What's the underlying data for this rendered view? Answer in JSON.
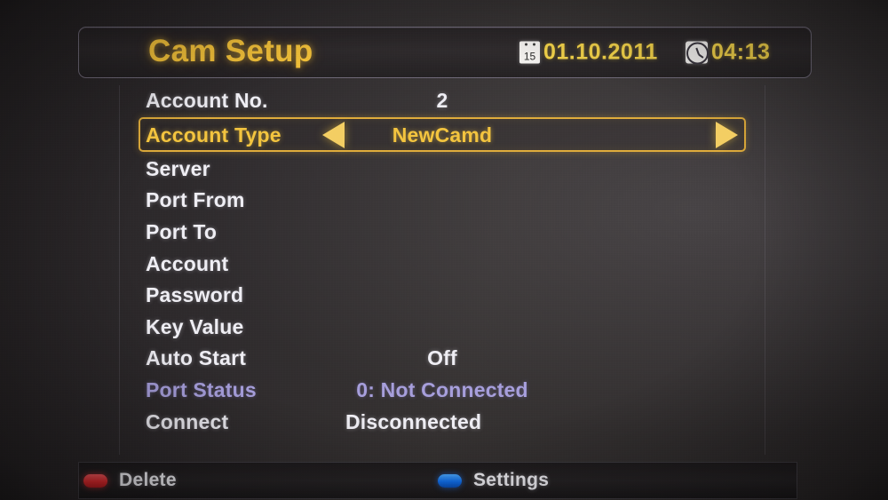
{
  "header": {
    "title": "Cam Setup",
    "date_icon": "calendar-icon",
    "date_icon_day": "15",
    "date": "01.10.2011",
    "time_icon": "clock-icon",
    "time": "04:13"
  },
  "menu": {
    "rows": [
      {
        "label": "Account No.",
        "value": "2",
        "state": "normal",
        "selected": false
      },
      {
        "label": "Account Type",
        "value": "NewCamd",
        "state": "normal",
        "selected": true
      },
      {
        "label": "Server",
        "value": "",
        "state": "normal",
        "selected": false
      },
      {
        "label": "Port From",
        "value": "",
        "state": "normal",
        "selected": false
      },
      {
        "label": "Port To",
        "value": "",
        "state": "normal",
        "selected": false
      },
      {
        "label": "Account",
        "value": "",
        "state": "normal",
        "selected": false
      },
      {
        "label": "Password",
        "value": "",
        "state": "normal",
        "selected": false
      },
      {
        "label": "Key Value",
        "value": "",
        "state": "normal",
        "selected": false
      },
      {
        "label": "Auto Start",
        "value": "Off",
        "state": "normal",
        "selected": false
      },
      {
        "label": "Port Status",
        "value": "0: Not Connected",
        "state": "dimmed",
        "selected": false
      },
      {
        "label": "Connect",
        "value": "Disconnected",
        "state": "normal",
        "selected": false,
        "value_align": "left-value"
      }
    ],
    "selected_left_arrow": "triangle-left-icon",
    "selected_right_arrow": "triangle-right-icon"
  },
  "bottom_bar": {
    "items": [
      {
        "key_color_name": "red-key",
        "color": "#e02a2e",
        "label": "Delete"
      },
      {
        "key_color_name": "blue-key",
        "color": "#1070ee",
        "label": "Settings"
      }
    ]
  },
  "colors": {
    "accent_yellow": "#f5c33a",
    "highlight_border": "#e0ad3c",
    "text_white": "#efeef4",
    "dimmed_purple": "#a79fdc",
    "background": "#2b2729"
  }
}
